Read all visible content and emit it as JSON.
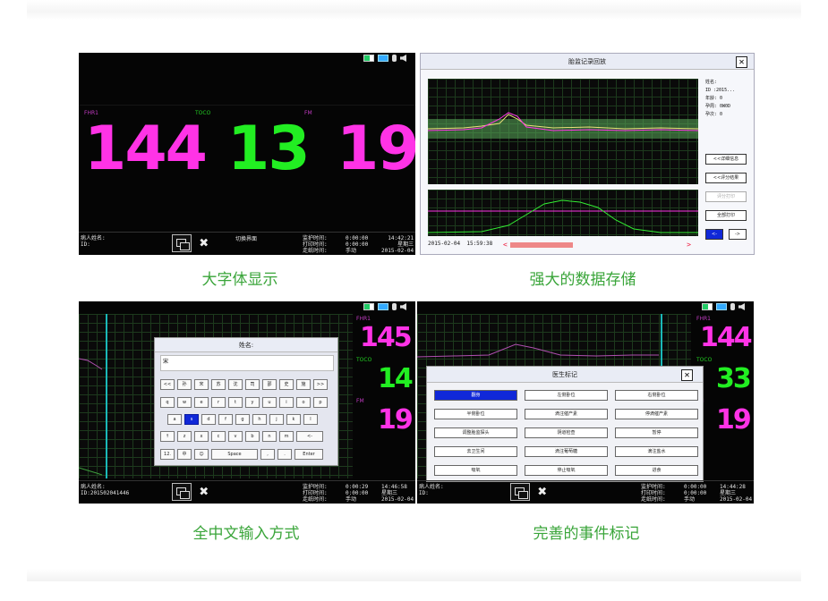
{
  "captions": {
    "panel1": "大字体显示",
    "panel2": "强大的数据存储",
    "panel3": "全中文输入方式",
    "panel4": "完善的事件标记"
  },
  "colors": {
    "magenta": "#ff33e6",
    "green": "#22ee22",
    "caption_green": "#3aa53a"
  },
  "panel1": {
    "labels": {
      "fhr": "FHR1",
      "toco": "TOCO",
      "fm": "FM"
    },
    "values": {
      "fhr": "144",
      "toco": "13",
      "fm": "19"
    },
    "footer": {
      "patient": "病人姓名:\nID:",
      "switch": "切换界面",
      "times_labels": "监护时间:\n打印时间:\n走纸时间:",
      "times_values": "0:00:00\n0:00:00\n手动",
      "clock": "14:42:21\n星期三\n2015-02-04"
    }
  },
  "panel2": {
    "title": "胎监记录回放",
    "info": "姓名:\nID :2015...\n年龄: 0\n孕周: 0W0D\n孕次: 0",
    "buttons": [
      "<<详细信息",
      "<<评分结果",
      "评分打印",
      "全部打印"
    ],
    "nav": [
      "<-",
      "->"
    ],
    "timestamp": "2015-02-04  15:59:38"
  },
  "panel3": {
    "title": "姓名:",
    "input_value": "宋",
    "candidates": [
      "<<",
      "孙",
      "宋",
      "苏",
      "沈",
      "司",
      "邵",
      "史",
      "施",
      ">>"
    ],
    "row1": [
      "q",
      "w",
      "e",
      "r",
      "t",
      "y",
      "u",
      "i",
      "o",
      "p"
    ],
    "row2": [
      "a",
      "s",
      "d",
      "f",
      "g",
      "h",
      "j",
      "k",
      "l"
    ],
    "row3": [
      "↑",
      "z",
      "x",
      "c",
      "v",
      "b",
      "n",
      "m",
      "<-"
    ],
    "row4": [
      "12.",
      "中",
      "☺",
      "Space",
      ",",
      ".",
      "Enter"
    ],
    "side_values": {
      "fhr": "145",
      "toco": "14",
      "fm": "19"
    },
    "side_labels": {
      "fhr": "FHR1",
      "toco": "TOCO",
      "fm": "FM"
    },
    "footer": {
      "patient": "病人姓名:\nID:201502041446",
      "times_labels": "监护时间:\n打印时间:\n走纸时间:",
      "times_values": "0:00:29\n0:00:00\n手动",
      "clock": "14:46:58\n星期三\n2015-02-04"
    }
  },
  "panel4": {
    "title": "医生标记",
    "buttons": [
      "翻身",
      "左侧卧位",
      "右侧卧位",
      "半侧卧位",
      "滴注催产素",
      "停滴催产素",
      "调整胎监探头",
      "阴道检查",
      "暂停",
      "去卫生间",
      "滴注葡萄糖",
      "滴注盐水",
      "吸氧",
      "停止吸氧",
      "进食"
    ],
    "side_values": {
      "fhr": "144",
      "toco": "33",
      "fm": "19"
    },
    "side_labels": {
      "fhr": "FHR1",
      "toco": "TOCO",
      "fm": "FM"
    },
    "footer": {
      "patient": "病人姓名:\nID:",
      "times_labels": "监护时间:\n打印时间:\n走纸时间:",
      "times_values": "0:00:00\n0:00:00\n手动",
      "clock": "14:44:28\n星期三\n2015-02-04"
    }
  }
}
